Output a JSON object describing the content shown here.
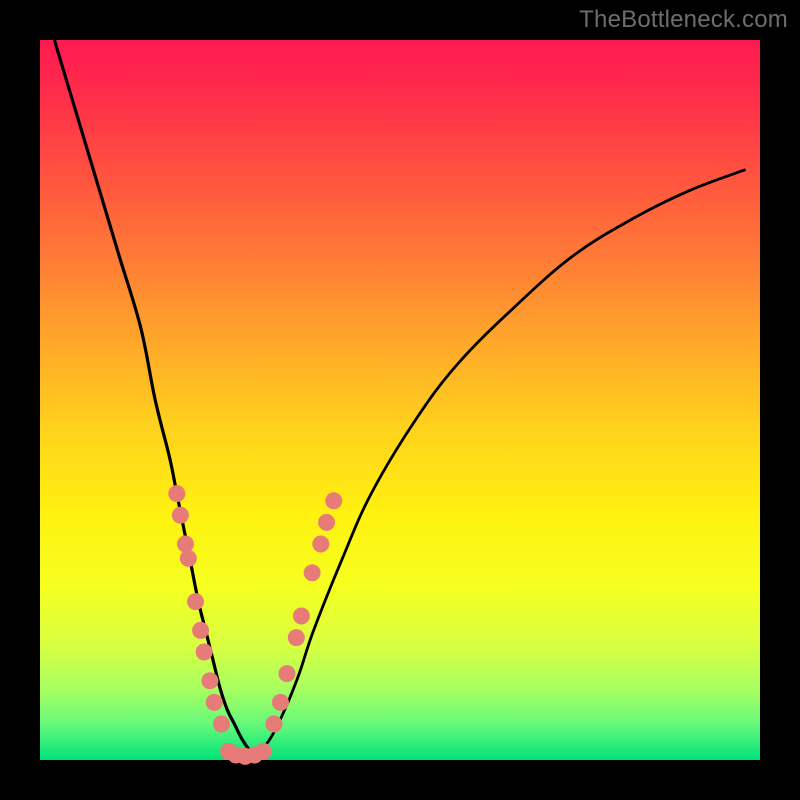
{
  "watermark": "TheBottleneck.com",
  "chart_data": {
    "type": "line",
    "title": "",
    "xlabel": "",
    "ylabel": "",
    "xlim": [
      0,
      100
    ],
    "ylim": [
      0,
      100
    ],
    "grid": false,
    "legend": false,
    "background_gradient": {
      "orientation": "vertical",
      "stops": [
        {
          "pos": 0.0,
          "color": "#ff1a52"
        },
        {
          "pos": 0.3,
          "color": "#ff7a36"
        },
        {
          "pos": 0.6,
          "color": "#ffe010"
        },
        {
          "pos": 0.9,
          "color": "#a8ff60"
        },
        {
          "pos": 1.0,
          "color": "#00e27a"
        }
      ]
    },
    "series": [
      {
        "name": "left_branch",
        "x": [
          2,
          5,
          8,
          11,
          14,
          16,
          18,
          19,
          20,
          21,
          22,
          23,
          24,
          25,
          26,
          27,
          28,
          29,
          30
        ],
        "y": [
          100,
          90,
          80,
          70,
          60,
          50,
          42,
          37,
          32,
          27,
          22,
          18,
          14,
          10,
          7,
          5,
          3,
          1.5,
          0.5
        ]
      },
      {
        "name": "right_branch",
        "x": [
          30,
          32,
          34,
          36,
          38,
          42,
          46,
          52,
          58,
          66,
          74,
          82,
          90,
          98
        ],
        "y": [
          0.5,
          3,
          7,
          12,
          18,
          28,
          37,
          47,
          55,
          63,
          70,
          75,
          79,
          82
        ]
      },
      {
        "name": "valley_floor",
        "x": [
          25,
          26,
          27,
          28,
          29,
          30,
          31,
          32
        ],
        "y": [
          0.6,
          0.4,
          0.3,
          0.2,
          0.2,
          0.3,
          0.4,
          0.6
        ]
      }
    ],
    "markers": [
      {
        "group": "left",
        "x": 19.0,
        "y": 37
      },
      {
        "group": "left",
        "x": 19.5,
        "y": 34
      },
      {
        "group": "left",
        "x": 20.2,
        "y": 30
      },
      {
        "group": "left",
        "x": 20.6,
        "y": 28
      },
      {
        "group": "left",
        "x": 21.6,
        "y": 22
      },
      {
        "group": "left",
        "x": 22.3,
        "y": 18
      },
      {
        "group": "left",
        "x": 22.8,
        "y": 15
      },
      {
        "group": "left",
        "x": 23.6,
        "y": 11
      },
      {
        "group": "left",
        "x": 24.2,
        "y": 8
      },
      {
        "group": "left",
        "x": 25.2,
        "y": 5
      },
      {
        "group": "floor",
        "x": 26.2,
        "y": 1.2
      },
      {
        "group": "floor",
        "x": 27.2,
        "y": 0.7
      },
      {
        "group": "floor",
        "x": 28.5,
        "y": 0.5
      },
      {
        "group": "floor",
        "x": 29.8,
        "y": 0.7
      },
      {
        "group": "floor",
        "x": 31.0,
        "y": 1.2
      },
      {
        "group": "right",
        "x": 32.5,
        "y": 5
      },
      {
        "group": "right",
        "x": 33.4,
        "y": 8
      },
      {
        "group": "right",
        "x": 34.3,
        "y": 12
      },
      {
        "group": "right",
        "x": 35.6,
        "y": 17
      },
      {
        "group": "right",
        "x": 36.3,
        "y": 20
      },
      {
        "group": "right",
        "x": 37.8,
        "y": 26
      },
      {
        "group": "right",
        "x": 39.0,
        "y": 30
      },
      {
        "group": "right",
        "x": 39.8,
        "y": 33
      },
      {
        "group": "right",
        "x": 40.8,
        "y": 36
      }
    ]
  }
}
